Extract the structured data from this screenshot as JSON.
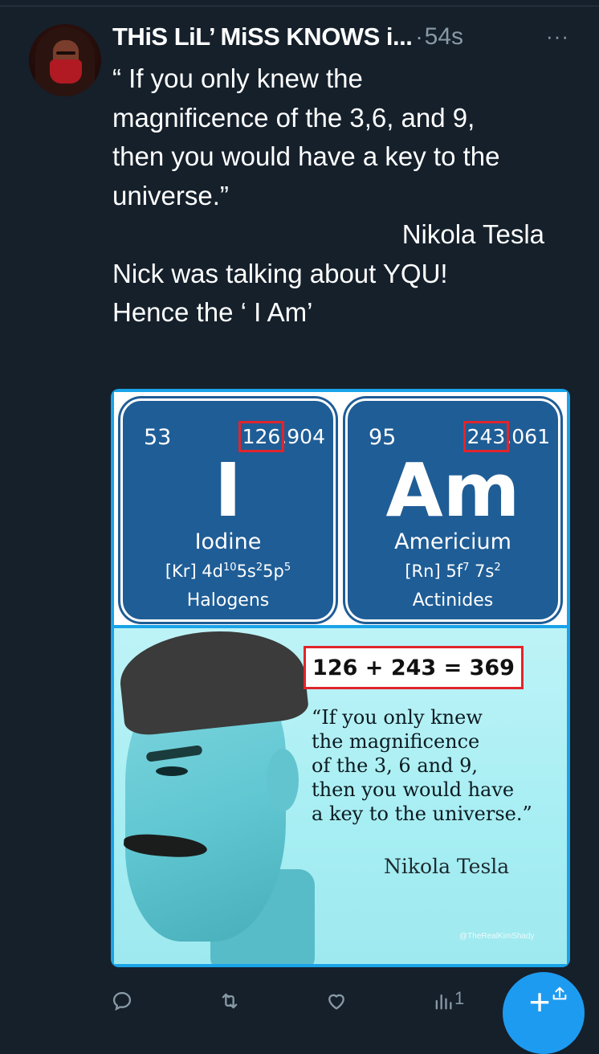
{
  "tweet": {
    "display_name": "THiS LiL’ MiSS KNOWS i...",
    "separator": "·",
    "time": "54s",
    "more": "···",
    "text_lines": [
      "“ If you only knew the",
      "magnificence of the 3,6, and 9,",
      "then you would have a key to the",
      "universe.”"
    ],
    "attribution": "Nikola Tesla",
    "text_lines_2": [
      "Nick was talking about YQU!",
      "Hence the ‘ I Am’"
    ]
  },
  "image": {
    "iodine": {
      "number": "53",
      "mass_int": "126",
      "mass_frac": ".904",
      "symbol": "I",
      "name": "Iodine",
      "config": "[Kr] 4d",
      "config_sup1": "10",
      "config_mid": "5s",
      "config_sup2": "2",
      "config_end": "5p",
      "config_sup3": "5",
      "group": "Halogens"
    },
    "americium": {
      "number": "95",
      "mass_int": "243",
      "mass_frac": ".061",
      "symbol": "Am",
      "name": "Americium",
      "config": "[Rn] 5f",
      "config_sup1": "7",
      "config_mid": " 7s",
      "config_sup2": "2",
      "group": "Actinides"
    },
    "equation": "126 + 243 = 369",
    "quote_lines": [
      "“If you only knew",
      "the magnificence",
      "of the 3, 6 and 9,",
      "then you would have",
      "a key to the universe.”"
    ],
    "signature": "Nikola Tesla",
    "watermark": "@TheRealKimShady"
  },
  "actions": {
    "reply_icon": "reply-icon",
    "retweet_icon": "retweet-icon",
    "like_icon": "heart-icon",
    "views_icon": "views-icon",
    "views_count": "1",
    "share_icon": "share-icon",
    "compose_icon": "compose-plus-icon",
    "plus": "+"
  },
  "colors": {
    "background": "#15202b",
    "secondary_text": "#8899a6",
    "accent": "#1d9bf0",
    "element_blue": "#1f5d96",
    "highlight_red": "#e0252c"
  }
}
